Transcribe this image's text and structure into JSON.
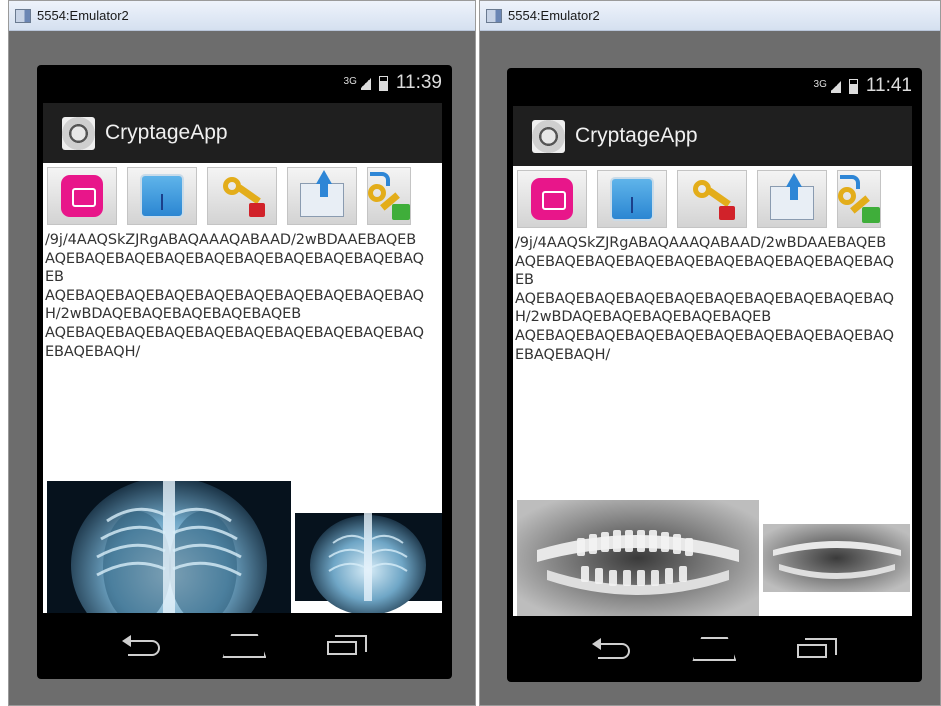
{
  "windows": [
    {
      "title": "5554:Emulator2",
      "status": {
        "network": "3G",
        "time": "11:39"
      },
      "app_title": "CryptageApp",
      "toolbar": [
        "camera-icon",
        "gallery-icon",
        "encrypt-keys-icon",
        "send-mail-icon",
        "decrypt-keys-icon"
      ],
      "encoded_text": "/9j/4AAQSkZJRgABAQAAAQABAAD/2wBDAAEBAQEBAQEBAQEBAQEBAQEBAQEBAQEBAQEBAQEBAQEBAQEB\nAQEBAQEBAQEBAQEBAQEBAQEBAQEBAQEBAQEBAQH/2wBDAQEBAQEBAQEBAQEBAQEB\nAQEBAQEBAQEBAQEBAQEBAQEBAQEBAQEBAQEBAQEBAQEBAQH/",
      "images": [
        "chest-xray-original",
        "chest-xray-small"
      ]
    },
    {
      "title": "5554:Emulator2",
      "status": {
        "network": "3G",
        "time": "11:41"
      },
      "app_title": "CryptageApp",
      "toolbar": [
        "camera-icon",
        "gallery-icon",
        "encrypt-keys-icon",
        "send-mail-icon",
        "decrypt-keys-icon"
      ],
      "encoded_text": "/9j/4AAQSkZJRgABAQAAAQABAAD/2wBDAAEBAQEBAQEBAQEBAQEBAQEBAQEBAQEBAQEBAQEBAQEBAQEB\nAQEBAQEBAQEBAQEBAQEBAQEBAQEBAQEBAQEBAQH/2wBDAQEBAQEBAQEBAQEBAQEB\nAQEBAQEBAQEBAQEBAQEBAQEBAQEBAQEBAQEBAQEBAQEBAQH/",
      "images": [
        "dental-xray-original",
        "dental-xray-small"
      ]
    }
  ]
}
